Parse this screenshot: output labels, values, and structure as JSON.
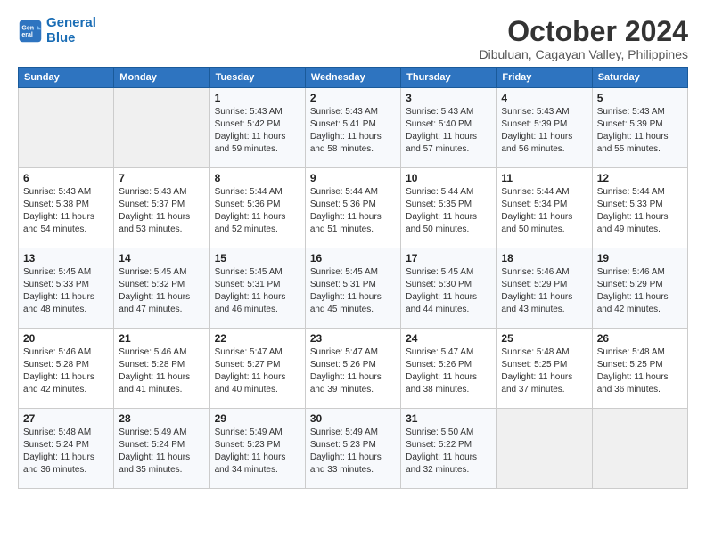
{
  "logo": {
    "line1": "General",
    "line2": "Blue"
  },
  "title": "October 2024",
  "subtitle": "Dibuluan, Cagayan Valley, Philippines",
  "header_days": [
    "Sunday",
    "Monday",
    "Tuesday",
    "Wednesday",
    "Thursday",
    "Friday",
    "Saturday"
  ],
  "weeks": [
    [
      {
        "day": "",
        "info": ""
      },
      {
        "day": "",
        "info": ""
      },
      {
        "day": "1",
        "info": "Sunrise: 5:43 AM\nSunset: 5:42 PM\nDaylight: 11 hours\nand 59 minutes."
      },
      {
        "day": "2",
        "info": "Sunrise: 5:43 AM\nSunset: 5:41 PM\nDaylight: 11 hours\nand 58 minutes."
      },
      {
        "day": "3",
        "info": "Sunrise: 5:43 AM\nSunset: 5:40 PM\nDaylight: 11 hours\nand 57 minutes."
      },
      {
        "day": "4",
        "info": "Sunrise: 5:43 AM\nSunset: 5:39 PM\nDaylight: 11 hours\nand 56 minutes."
      },
      {
        "day": "5",
        "info": "Sunrise: 5:43 AM\nSunset: 5:39 PM\nDaylight: 11 hours\nand 55 minutes."
      }
    ],
    [
      {
        "day": "6",
        "info": "Sunrise: 5:43 AM\nSunset: 5:38 PM\nDaylight: 11 hours\nand 54 minutes."
      },
      {
        "day": "7",
        "info": "Sunrise: 5:43 AM\nSunset: 5:37 PM\nDaylight: 11 hours\nand 53 minutes."
      },
      {
        "day": "8",
        "info": "Sunrise: 5:44 AM\nSunset: 5:36 PM\nDaylight: 11 hours\nand 52 minutes."
      },
      {
        "day": "9",
        "info": "Sunrise: 5:44 AM\nSunset: 5:36 PM\nDaylight: 11 hours\nand 51 minutes."
      },
      {
        "day": "10",
        "info": "Sunrise: 5:44 AM\nSunset: 5:35 PM\nDaylight: 11 hours\nand 50 minutes."
      },
      {
        "day": "11",
        "info": "Sunrise: 5:44 AM\nSunset: 5:34 PM\nDaylight: 11 hours\nand 50 minutes."
      },
      {
        "day": "12",
        "info": "Sunrise: 5:44 AM\nSunset: 5:33 PM\nDaylight: 11 hours\nand 49 minutes."
      }
    ],
    [
      {
        "day": "13",
        "info": "Sunrise: 5:45 AM\nSunset: 5:33 PM\nDaylight: 11 hours\nand 48 minutes."
      },
      {
        "day": "14",
        "info": "Sunrise: 5:45 AM\nSunset: 5:32 PM\nDaylight: 11 hours\nand 47 minutes."
      },
      {
        "day": "15",
        "info": "Sunrise: 5:45 AM\nSunset: 5:31 PM\nDaylight: 11 hours\nand 46 minutes."
      },
      {
        "day": "16",
        "info": "Sunrise: 5:45 AM\nSunset: 5:31 PM\nDaylight: 11 hours\nand 45 minutes."
      },
      {
        "day": "17",
        "info": "Sunrise: 5:45 AM\nSunset: 5:30 PM\nDaylight: 11 hours\nand 44 minutes."
      },
      {
        "day": "18",
        "info": "Sunrise: 5:46 AM\nSunset: 5:29 PM\nDaylight: 11 hours\nand 43 minutes."
      },
      {
        "day": "19",
        "info": "Sunrise: 5:46 AM\nSunset: 5:29 PM\nDaylight: 11 hours\nand 42 minutes."
      }
    ],
    [
      {
        "day": "20",
        "info": "Sunrise: 5:46 AM\nSunset: 5:28 PM\nDaylight: 11 hours\nand 42 minutes."
      },
      {
        "day": "21",
        "info": "Sunrise: 5:46 AM\nSunset: 5:28 PM\nDaylight: 11 hours\nand 41 minutes."
      },
      {
        "day": "22",
        "info": "Sunrise: 5:47 AM\nSunset: 5:27 PM\nDaylight: 11 hours\nand 40 minutes."
      },
      {
        "day": "23",
        "info": "Sunrise: 5:47 AM\nSunset: 5:26 PM\nDaylight: 11 hours\nand 39 minutes."
      },
      {
        "day": "24",
        "info": "Sunrise: 5:47 AM\nSunset: 5:26 PM\nDaylight: 11 hours\nand 38 minutes."
      },
      {
        "day": "25",
        "info": "Sunrise: 5:48 AM\nSunset: 5:25 PM\nDaylight: 11 hours\nand 37 minutes."
      },
      {
        "day": "26",
        "info": "Sunrise: 5:48 AM\nSunset: 5:25 PM\nDaylight: 11 hours\nand 36 minutes."
      }
    ],
    [
      {
        "day": "27",
        "info": "Sunrise: 5:48 AM\nSunset: 5:24 PM\nDaylight: 11 hours\nand 36 minutes."
      },
      {
        "day": "28",
        "info": "Sunrise: 5:49 AM\nSunset: 5:24 PM\nDaylight: 11 hours\nand 35 minutes."
      },
      {
        "day": "29",
        "info": "Sunrise: 5:49 AM\nSunset: 5:23 PM\nDaylight: 11 hours\nand 34 minutes."
      },
      {
        "day": "30",
        "info": "Sunrise: 5:49 AM\nSunset: 5:23 PM\nDaylight: 11 hours\nand 33 minutes."
      },
      {
        "day": "31",
        "info": "Sunrise: 5:50 AM\nSunset: 5:22 PM\nDaylight: 11 hours\nand 32 minutes."
      },
      {
        "day": "",
        "info": ""
      },
      {
        "day": "",
        "info": ""
      }
    ]
  ]
}
